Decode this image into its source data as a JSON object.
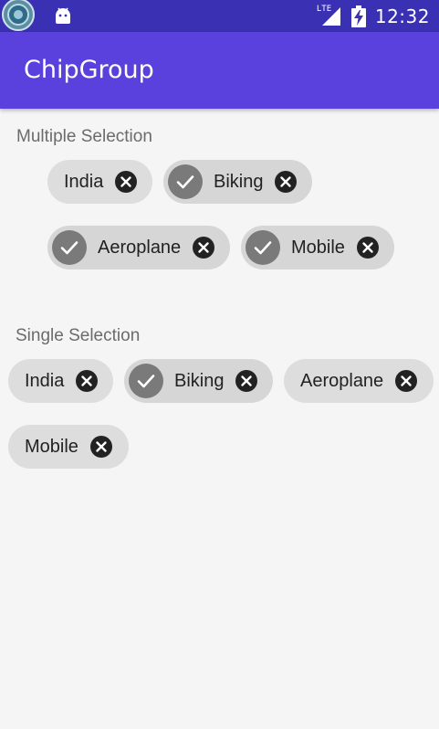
{
  "status_bar": {
    "time": "12:32",
    "network_label": "LTE",
    "background": "#3a30b3"
  },
  "app_bar": {
    "title": "ChipGroup",
    "background": "#5a40dd"
  },
  "multiple_selection": {
    "label": "Multiple Selection",
    "chips": [
      {
        "label": "India",
        "checked": false
      },
      {
        "label": "Biking",
        "checked": true
      },
      {
        "label": "Aeroplane",
        "checked": true
      },
      {
        "label": "Mobile",
        "checked": true
      }
    ]
  },
  "single_selection": {
    "label": "Single Selection",
    "chips": [
      {
        "label": "India",
        "checked": false
      },
      {
        "label": "Biking",
        "checked": true
      },
      {
        "label": "Aeroplane",
        "checked": false
      },
      {
        "label": "Mobile",
        "checked": false
      }
    ]
  },
  "icons": {
    "check": "check-icon",
    "close": "close-circle-icon"
  },
  "colors": {
    "chip_bg": "#dddddd",
    "check_bg": "#7a7a7a",
    "close_bg": "#222222",
    "page_bg": "#f5f5f5"
  }
}
